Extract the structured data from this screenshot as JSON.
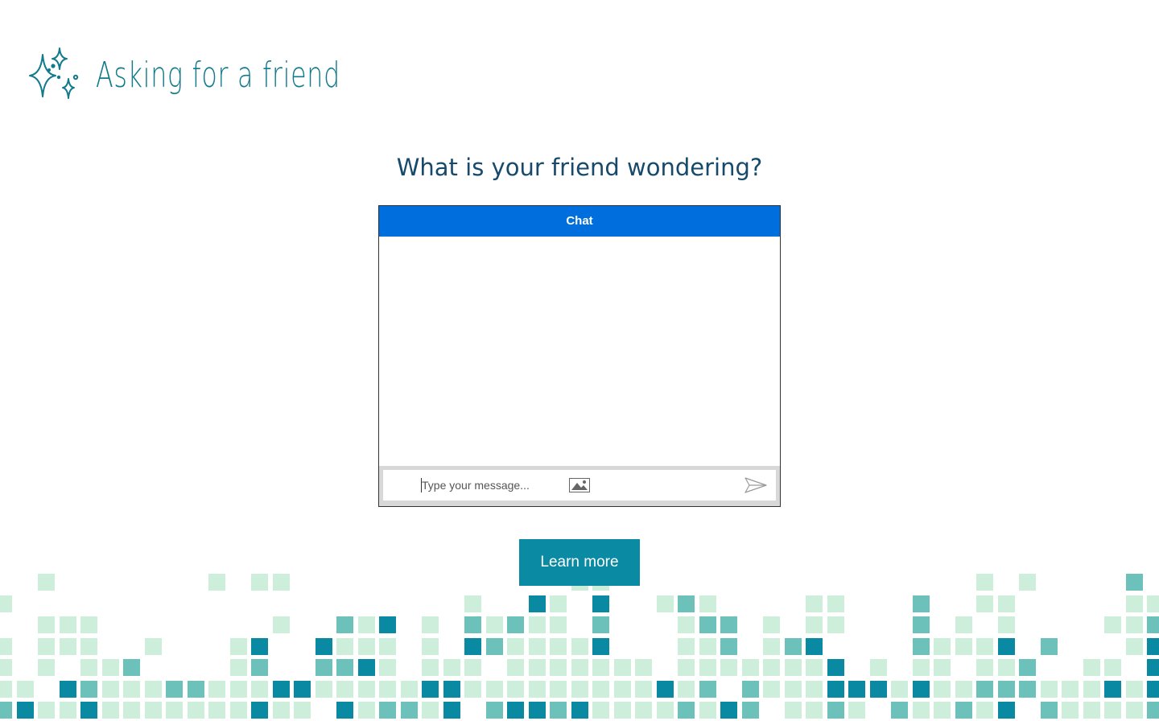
{
  "brand": {
    "name": "Asking for a friend"
  },
  "headline": "What is your friend wondering?",
  "chat": {
    "title": "Chat",
    "input_placeholder": "Type your message...",
    "input_value": ""
  },
  "cta": {
    "learn_more_label": "Learn more"
  },
  "colors": {
    "brand_teal": "#117a8b",
    "headline_navy": "#17496b",
    "chat_header_blue": "#006edc",
    "button_teal": "#0a8aa3",
    "tile_light": "#cdeedb",
    "tile_medium": "#6cc2bb",
    "tile_dark": "#0a89a2"
  },
  "icons": [
    "sparkles-logo-icon",
    "image-upload-icon",
    "send-icon"
  ]
}
